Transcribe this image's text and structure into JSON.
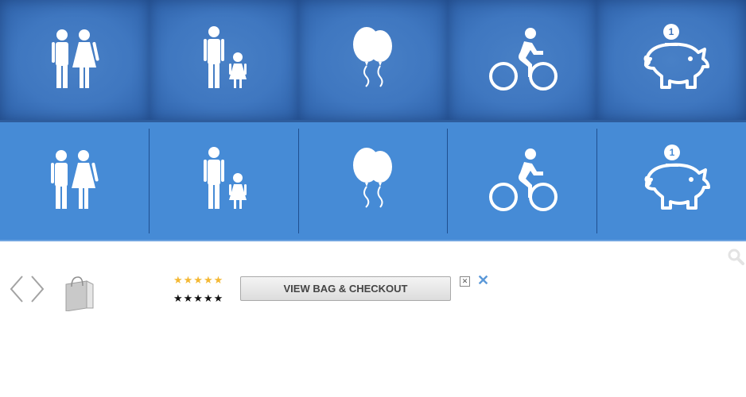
{
  "categories": [
    {
      "icon": "couple-icon"
    },
    {
      "icon": "parent-child-icon"
    },
    {
      "icon": "balloons-icon"
    },
    {
      "icon": "cyclist-icon"
    },
    {
      "icon": "piggy-bank-icon"
    }
  ],
  "piggy_coin": "1",
  "ratings": {
    "gold": "★★★★★",
    "black": "★★★★★"
  },
  "checkout": {
    "label": "VIEW BAG & CHECKOUT"
  },
  "ad": {
    "small_close": "✕",
    "close": "✕"
  },
  "colors": {
    "row1": "#3d74bd",
    "row2": "#468bd6",
    "accent": "#5a98d8",
    "star_gold": "#f4b833"
  }
}
